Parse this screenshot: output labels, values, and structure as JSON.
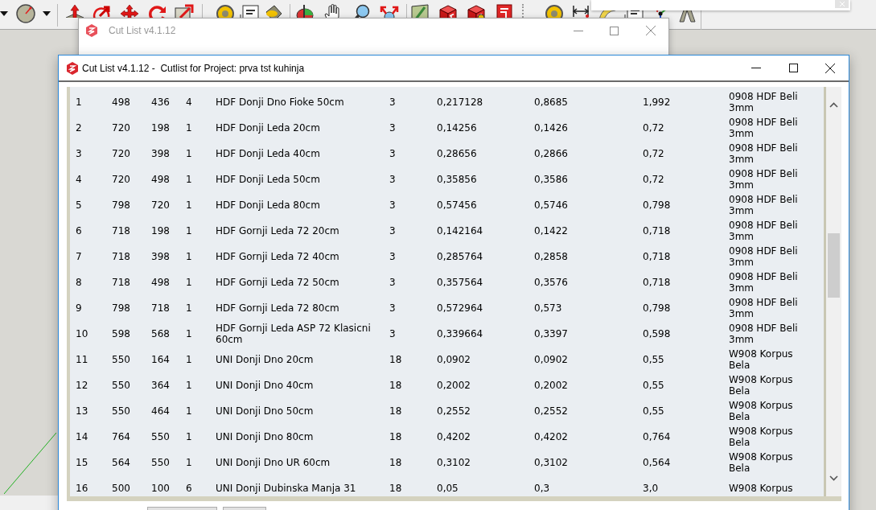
{
  "background_window": {
    "title": "Cut List v4.1.12"
  },
  "window": {
    "title": "Cut List v4.1.12 -  Cutlist for Project: prva tst kuhinja",
    "table": {
      "rows": [
        [
          "1",
          "498",
          "436",
          "4",
          "HDF Donji Dno Fioke 50cm",
          "3",
          "0,217128",
          "0,8685",
          "1,992",
          "0908 HDF Beli 3mm"
        ],
        [
          "2",
          "720",
          "198",
          "1",
          "HDF Donji Leda 20cm",
          "3",
          "0,14256",
          "0,1426",
          "0,72",
          "0908 HDF Beli 3mm"
        ],
        [
          "3",
          "720",
          "398",
          "1",
          "HDF Donji Leda 40cm",
          "3",
          "0,28656",
          "0,2866",
          "0,72",
          "0908 HDF Beli 3mm"
        ],
        [
          "4",
          "720",
          "498",
          "1",
          "HDF Donji Leda 50cm",
          "3",
          "0,35856",
          "0,3586",
          "0,72",
          "0908 HDF Beli 3mm"
        ],
        [
          "5",
          "798",
          "720",
          "1",
          "HDF Donji Leda 80cm",
          "3",
          "0,57456",
          "0,5746",
          "0,798",
          "0908 HDF Beli 3mm"
        ],
        [
          "6",
          "718",
          "198",
          "1",
          "HDF Gornji Leda 72 20cm",
          "3",
          "0,142164",
          "0,1422",
          "0,718",
          "0908 HDF Beli 3mm"
        ],
        [
          "7",
          "718",
          "398",
          "1",
          "HDF Gornji Leda 72 40cm",
          "3",
          "0,285764",
          "0,2858",
          "0,718",
          "0908 HDF Beli 3mm"
        ],
        [
          "8",
          "718",
          "498",
          "1",
          "HDF Gornji Leda 72 50cm",
          "3",
          "0,357564",
          "0,3576",
          "0,718",
          "0908 HDF Beli 3mm"
        ],
        [
          "9",
          "798",
          "718",
          "1",
          "HDF Gornji Leda 72 80cm",
          "3",
          "0,572964",
          "0,573",
          "0,798",
          "0908 HDF Beli 3mm"
        ],
        [
          "10",
          "598",
          "568",
          "1",
          "HDF Gornji Leda ASP 72 Klasicni 60cm",
          "3",
          "0,339664",
          "0,3397",
          "0,598",
          "0908 HDF Beli 3mm"
        ],
        [
          "11",
          "550",
          "164",
          "1",
          "UNI Donji Dno 20cm",
          "18",
          "0,0902",
          "0,0902",
          "0,55",
          "W908 Korpus Bela"
        ],
        [
          "12",
          "550",
          "364",
          "1",
          "UNI Donji Dno 40cm",
          "18",
          "0,2002",
          "0,2002",
          "0,55",
          "W908 Korpus Bela"
        ],
        [
          "13",
          "550",
          "464",
          "1",
          "UNI Donji Dno 50cm",
          "18",
          "0,2552",
          "0,2552",
          "0,55",
          "W908 Korpus Bela"
        ],
        [
          "14",
          "764",
          "550",
          "1",
          "UNI Donji Dno 80cm",
          "18",
          "0,4202",
          "0,4202",
          "0,764",
          "W908 Korpus Bela"
        ],
        [
          "15",
          "564",
          "550",
          "1",
          "UNI Donji Dno UR 60cm",
          "18",
          "0,3102",
          "0,3102",
          "0,564",
          "W908 Korpus Bela"
        ],
        [
          "16",
          "500",
          "100",
          "6",
          "UNI Donji Dubinska Manja 31",
          "18",
          "0,05",
          "0,3",
          "3,0",
          "W908 Korpus"
        ]
      ]
    }
  }
}
